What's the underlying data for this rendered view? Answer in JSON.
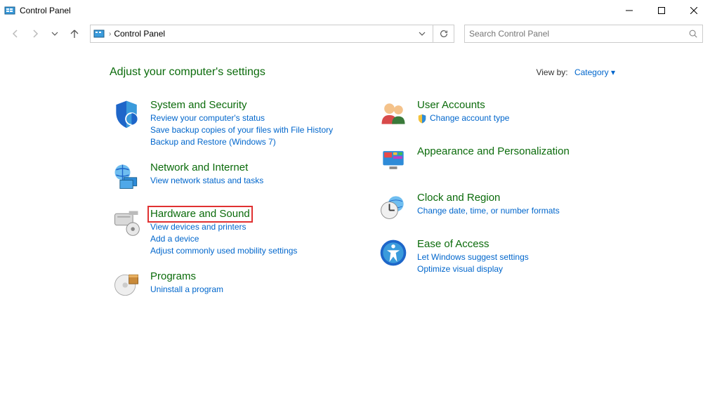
{
  "window": {
    "title": "Control Panel"
  },
  "breadcrumb": {
    "current": "Control Panel"
  },
  "search": {
    "placeholder": "Search Control Panel"
  },
  "header": {
    "heading": "Adjust your computer's settings",
    "viewby_label": "View by:",
    "viewby_value": "Category"
  },
  "left": [
    {
      "title": "System and Security",
      "links": [
        "Review your computer's status",
        "Save backup copies of your files with File History",
        "Backup and Restore (Windows 7)"
      ],
      "shield": []
    },
    {
      "title": "Network and Internet",
      "links": [
        "View network status and tasks"
      ],
      "shield": []
    },
    {
      "title": "Hardware and Sound",
      "links": [
        "View devices and printers",
        "Add a device",
        "Adjust commonly used mobility settings"
      ],
      "shield": [],
      "highlight": true
    },
    {
      "title": "Programs",
      "links": [
        "Uninstall a program"
      ],
      "shield": []
    }
  ],
  "right": [
    {
      "title": "User Accounts",
      "links": [
        "Change account type"
      ],
      "shield": [
        0
      ]
    },
    {
      "title": "Appearance and Personalization",
      "links": [],
      "shield": []
    },
    {
      "title": "Clock and Region",
      "links": [
        "Change date, time, or number formats"
      ],
      "shield": []
    },
    {
      "title": "Ease of Access",
      "links": [
        "Let Windows suggest settings",
        "Optimize visual display"
      ],
      "shield": []
    }
  ]
}
